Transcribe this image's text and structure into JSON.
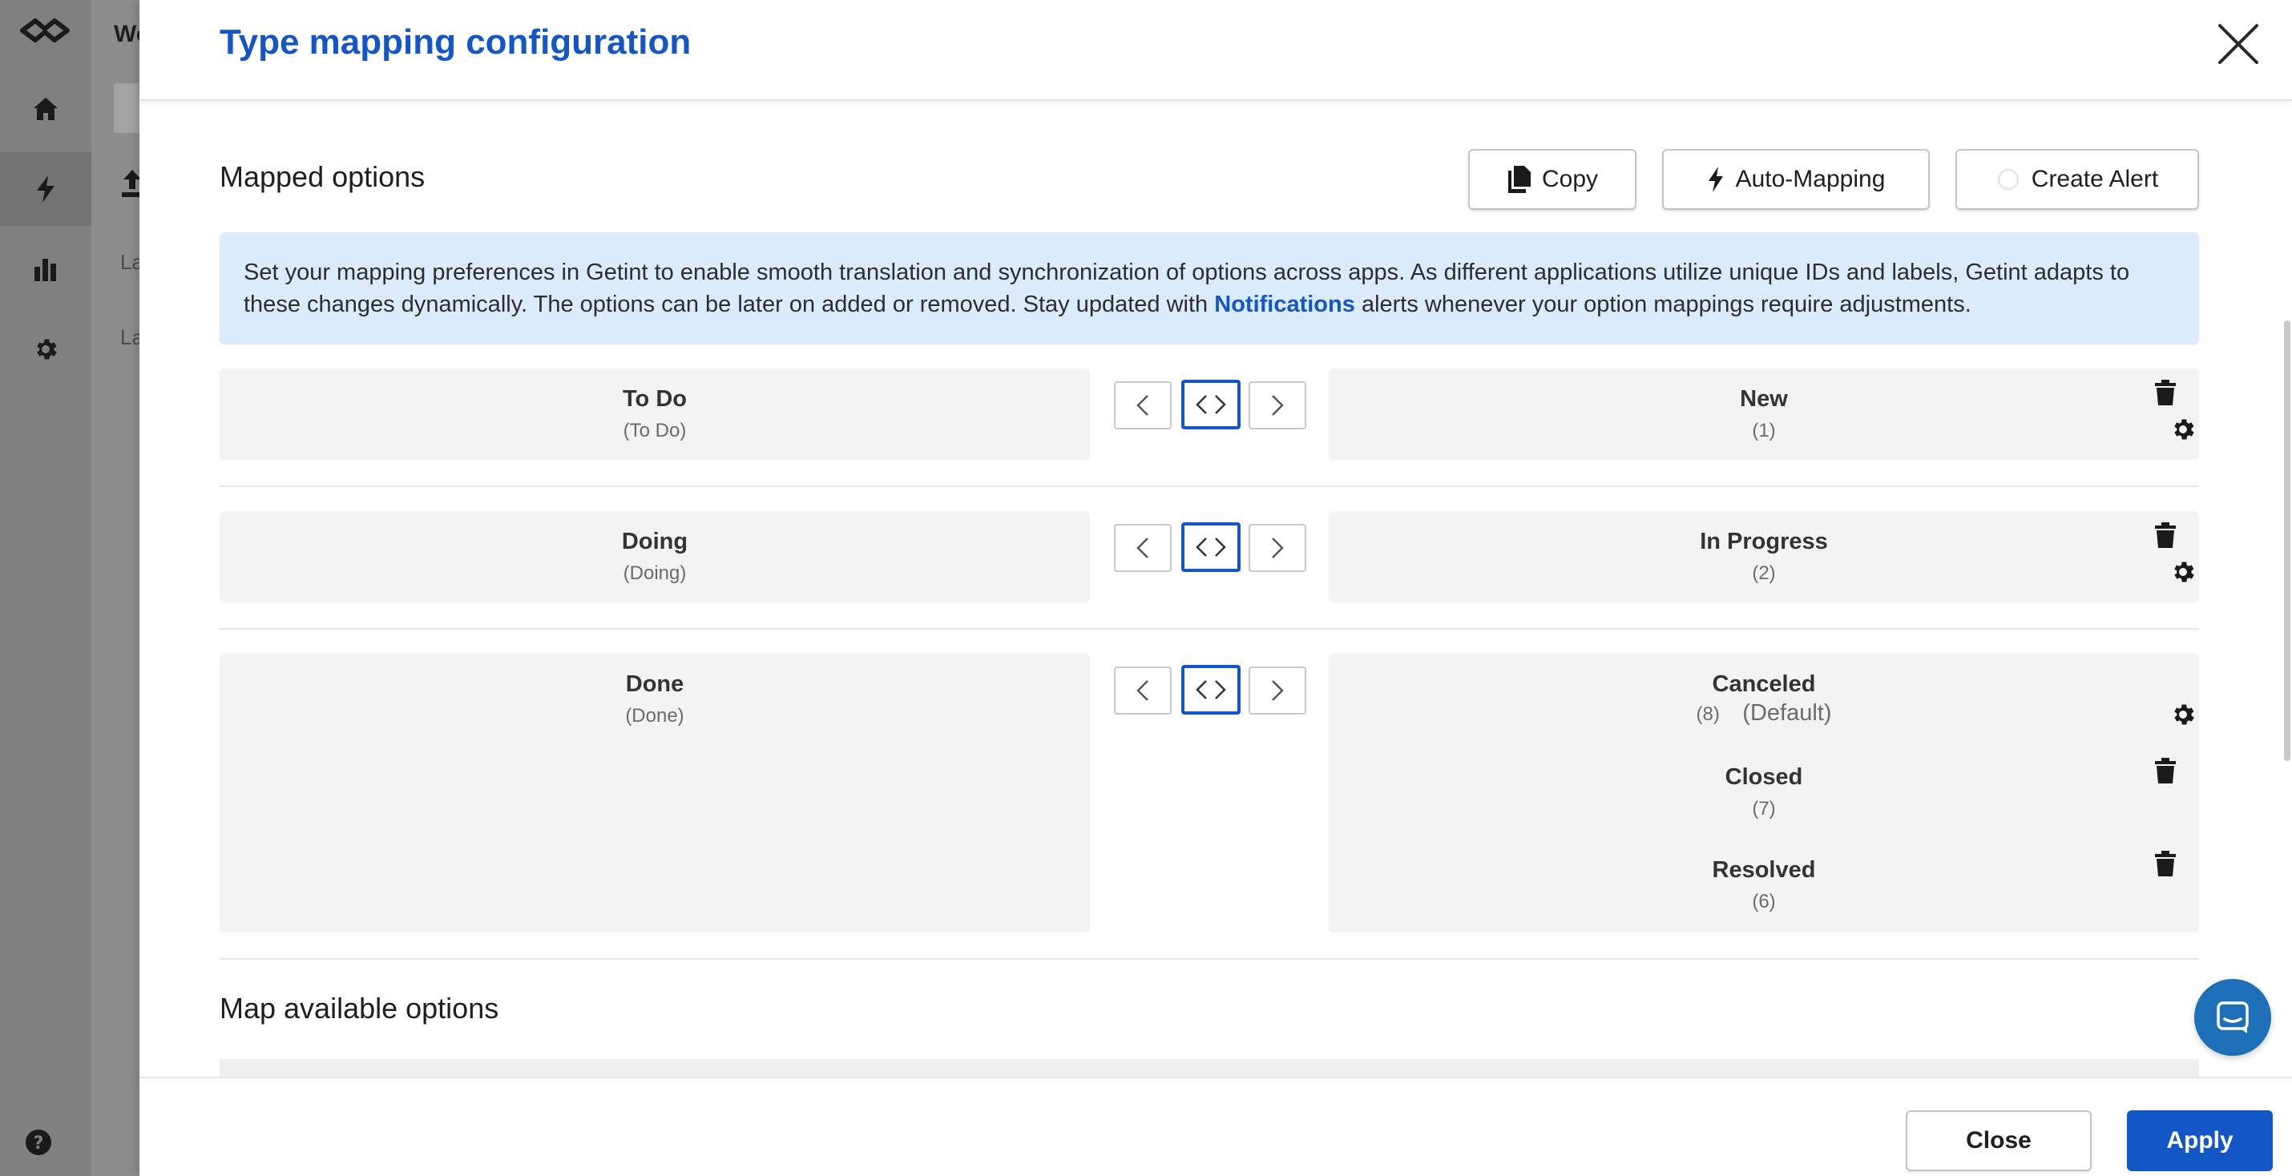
{
  "background": {
    "app_title": "Wo",
    "list_items": [
      "La",
      "La"
    ]
  },
  "modal": {
    "title": "Type mapping configuration"
  },
  "mapped": {
    "section_title": "Mapped options",
    "copy_label": "Copy",
    "auto_mapping_label": "Auto-Mapping",
    "create_alert_label": "Create Alert",
    "info_text": "Set your mapping preferences in Getint to enable smooth translation and synchronization of options across apps. As different applications utilize unique IDs and labels, Getint adapts to these changes dynamically. The options can be later on added or removed. Stay updated with",
    "info_link": "Notifications",
    "info_text_end": "alerts whenever your option mappings require adjustments.",
    "rows": [
      {
        "left_name": "To Do",
        "left_id": "(To Do)",
        "right": [
          {
            "name": "New",
            "id": "(1)"
          }
        ]
      },
      {
        "left_name": "Doing",
        "left_id": "(Doing)",
        "right": [
          {
            "name": "In Progress",
            "id": "(2)"
          }
        ]
      },
      {
        "left_name": "Done",
        "left_id": "(Done)",
        "right": [
          {
            "name": "Canceled",
            "id": "(8)",
            "default": "(Default)"
          },
          {
            "name": "Closed",
            "id": "(7)"
          },
          {
            "name": "Resolved",
            "id": "(6)"
          }
        ]
      }
    ]
  },
  "available": {
    "section_title": "Map available options"
  },
  "footer": {
    "close_label": "Close",
    "apply_label": "Apply"
  },
  "colors": {
    "accent": "#1456c8",
    "info_bg": "#dcebfc",
    "row_bg": "#f3f3f3"
  }
}
